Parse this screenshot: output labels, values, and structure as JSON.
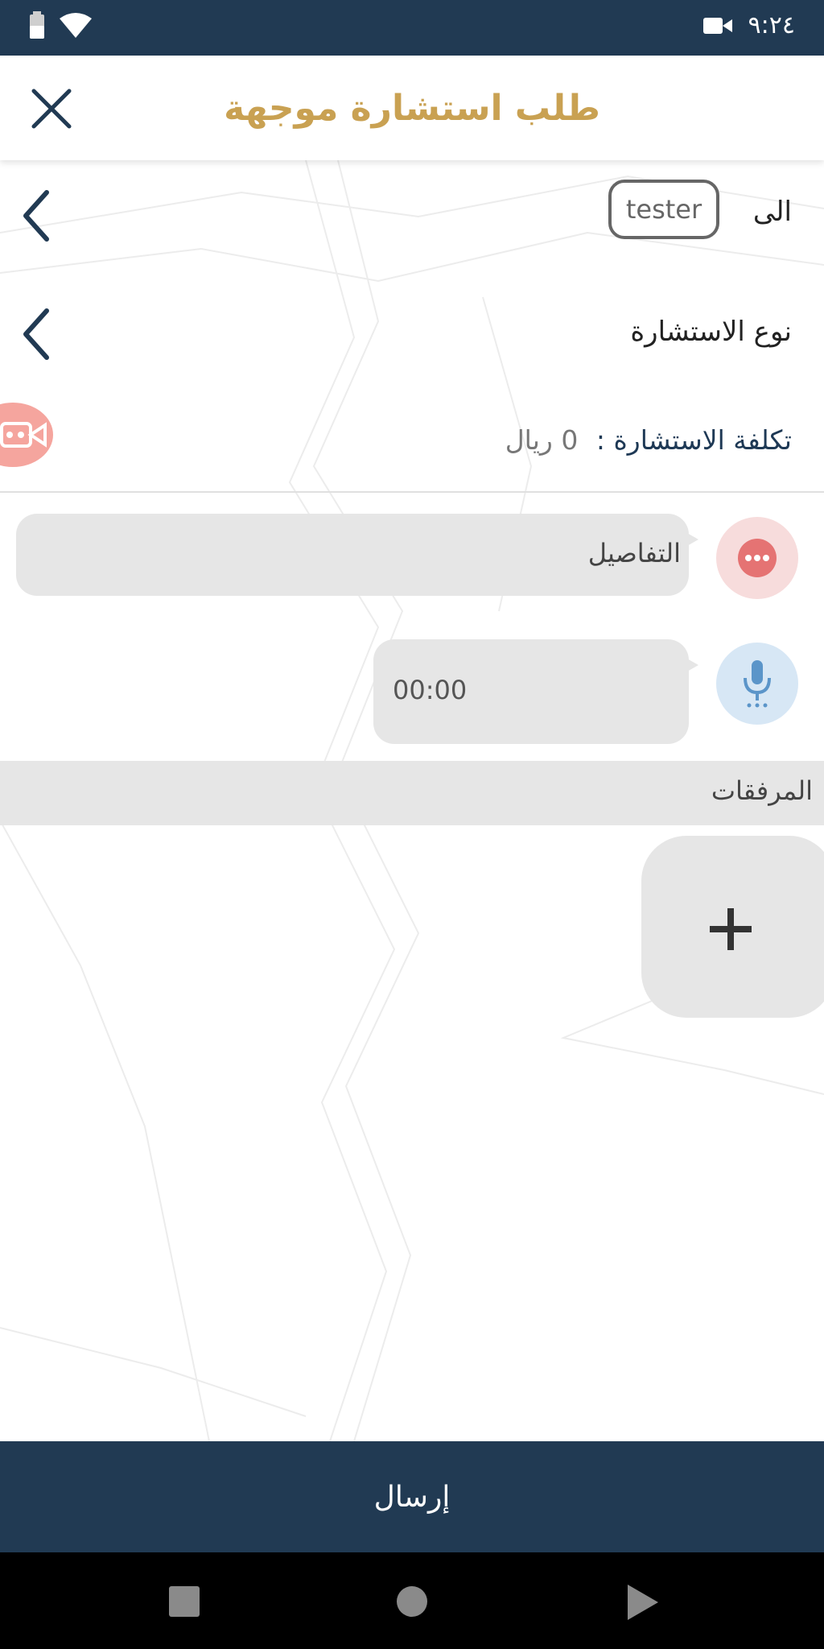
{
  "status_bar": {
    "time": "٩:٢٤"
  },
  "header": {
    "title": "طلب استشارة موجهة"
  },
  "to_row": {
    "label": "الى",
    "recipient": "tester"
  },
  "type_row": {
    "label": "نوع الاستشارة"
  },
  "cost_row": {
    "label": "تكلفة الاستشارة :",
    "value": "0 ريال"
  },
  "details": {
    "placeholder": "التفاصيل"
  },
  "audio": {
    "duration": "00:00"
  },
  "attachments": {
    "title": "المرفقات"
  },
  "send_button": {
    "label": "إرسال"
  },
  "colors": {
    "primary": "#213a53",
    "accent": "#c9a152",
    "surface": "#e6e6e6",
    "video_button": "#f5a59e",
    "details_icon": "#e57373",
    "mic_icon": "#5b95c9"
  },
  "icons": [
    "battery-icon",
    "wifi-icon",
    "video-camera-icon",
    "close-icon",
    "chevron-left-icon",
    "dots-icon",
    "microphone-icon",
    "plus-icon"
  ]
}
